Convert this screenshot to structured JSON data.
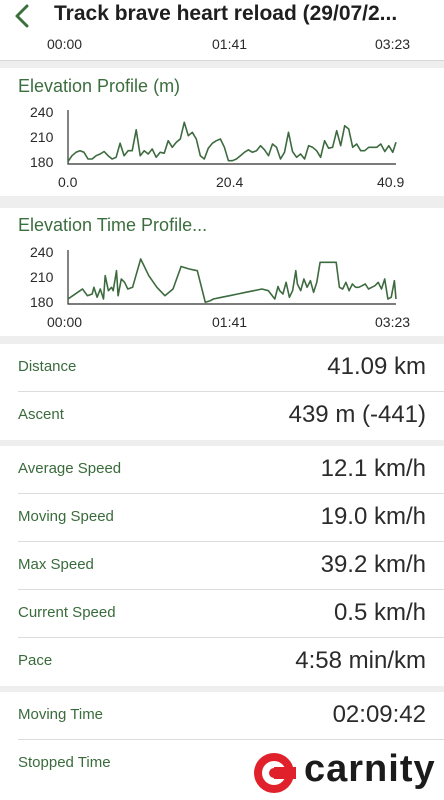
{
  "header": {
    "title": "Track brave heart reload  (29/07/2..."
  },
  "top_axis": {
    "ticks": [
      "00:00",
      "01:41",
      "03:23"
    ]
  },
  "elevation_profile": {
    "title": "Elevation Profile (m)"
  },
  "elevation_time_profile": {
    "title": "Elevation Time Profile..."
  },
  "chart_data": [
    {
      "type": "line",
      "title": "Elevation Profile (m)",
      "xlabel": "",
      "ylabel": "",
      "xlim": [
        0,
        40.9
      ],
      "ylim": [
        180,
        240
      ],
      "y_ticks": [
        "240",
        "210",
        "180"
      ],
      "x_ticks": [
        "0.0",
        "20.4",
        "40.9"
      ],
      "grid": false,
      "color": "#3d6b3f",
      "x": [
        0,
        0.5,
        1,
        1.5,
        2,
        2.5,
        3,
        3.5,
        4,
        4.5,
        5,
        5.5,
        6,
        6.5,
        7,
        7.5,
        8,
        8.5,
        9,
        9.5,
        10,
        10.5,
        11,
        11.5,
        12,
        12.5,
        13,
        13.5,
        14,
        14.5,
        15,
        15.5,
        16,
        16.5,
        17,
        17.5,
        18,
        18.5,
        19,
        19.5,
        20,
        20.5,
        21,
        21.5,
        22,
        22.5,
        23,
        23.5,
        24,
        24.5,
        25,
        25.5,
        26,
        26.5,
        27,
        27.5,
        28,
        28.5,
        29,
        29.5,
        30,
        30.5,
        31,
        31.5,
        32,
        32.5,
        33,
        33.5,
        34,
        34.5,
        35,
        35.5,
        36,
        36.5,
        37,
        37.5,
        38,
        38.5,
        39,
        39.5,
        40,
        40.5,
        40.9
      ],
      "y": [
        183,
        190,
        194,
        196,
        194,
        186,
        186,
        190,
        192,
        195,
        190,
        186,
        188,
        205,
        190,
        196,
        196,
        221,
        190,
        196,
        192,
        198,
        188,
        194,
        193,
        208,
        200,
        206,
        210,
        230,
        214,
        218,
        210,
        190,
        186,
        199,
        205,
        208,
        210,
        200,
        184,
        184,
        186,
        190,
        194,
        197,
        194,
        196,
        202,
        197,
        190,
        204,
        200,
        186,
        194,
        218,
        195,
        188,
        192,
        186,
        202,
        200,
        196,
        188,
        208,
        199,
        200,
        220,
        202,
        226,
        222,
        200,
        204,
        196,
        196,
        200,
        200,
        200,
        204,
        195,
        202,
        194,
        206,
        200,
        202,
        208,
        204,
        206,
        200,
        204,
        198,
        196,
        206,
        186,
        184,
        216,
        184,
        186
      ]
    },
    {
      "type": "line",
      "title": "Elevation Time Profile...",
      "xlabel": "",
      "ylabel": "",
      "xlim": [
        "00:00",
        "03:23"
      ],
      "ylim": [
        180,
        240
      ],
      "y_ticks": [
        "240",
        "210",
        "180"
      ],
      "x_ticks": [
        "00:00",
        "01:41",
        "03:23"
      ],
      "grid": false,
      "color": "#3d6b3f",
      "x": [
        0,
        3,
        6,
        9,
        12,
        15,
        16,
        18,
        20,
        22,
        23,
        25,
        27,
        28,
        30,
        31,
        33,
        35,
        37,
        40,
        42,
        45,
        50,
        55,
        60,
        65,
        70,
        75,
        80,
        85,
        88,
        90,
        95,
        100,
        105,
        110,
        115,
        120,
        124,
        128,
        130,
        131,
        133,
        135,
        137,
        139,
        141,
        142,
        144,
        146,
        148,
        150,
        152,
        154,
        156,
        158,
        160,
        162,
        164,
        166,
        168,
        170,
        172,
        174,
        176,
        178,
        180,
        182,
        184,
        186,
        188,
        190,
        192,
        194,
        196,
        198,
        200,
        202,
        203
      ],
      "y": [
        186,
        190,
        194,
        198,
        190,
        192,
        200,
        188,
        198,
        186,
        214,
        196,
        200,
        196,
        220,
        190,
        210,
        206,
        198,
        200,
        214,
        234,
        214,
        200,
        190,
        198,
        225,
        222,
        220,
        182,
        184,
        186,
        188,
        190,
        192,
        194,
        196,
        198,
        196,
        186,
        201,
        196,
        192,
        206,
        188,
        196,
        220,
        204,
        196,
        210,
        200,
        208,
        194,
        206,
        230,
        230,
        230,
        230,
        230,
        230,
        200,
        198,
        206,
        196,
        204,
        200,
        200,
        202,
        204,
        198,
        200,
        202,
        206,
        198,
        210,
        186,
        188,
        208,
        186
      ]
    },
    {
      "type": "table",
      "title": "",
      "rows": [
        {
          "label": "Distance",
          "value": "41.09 km"
        },
        {
          "label": "Ascent",
          "value": "439 m (-441)"
        },
        {
          "label": "Average Speed",
          "value": "12.1 km/h"
        },
        {
          "label": "Moving Speed",
          "value": "19.0 km/h"
        },
        {
          "label": "Max Speed",
          "value": "39.2 km/h"
        },
        {
          "label": "Current Speed",
          "value": "0.5 km/h"
        },
        {
          "label": "Pace",
          "value": "4:58 min/km"
        },
        {
          "label": "Moving Time",
          "value": "02:09:42"
        },
        {
          "label": "Stopped Time",
          "value": ""
        }
      ]
    }
  ],
  "stats": {
    "distance": {
      "label": "Distance",
      "value": "41.09 km"
    },
    "ascent": {
      "label": "Ascent",
      "value": "439 m (-441)"
    },
    "average_speed": {
      "label": "Average Speed",
      "value": "12.1 km/h"
    },
    "moving_speed": {
      "label": "Moving Speed",
      "value": "19.0 km/h"
    },
    "max_speed": {
      "label": "Max Speed",
      "value": "39.2 km/h"
    },
    "current_speed": {
      "label": "Current Speed",
      "value": "0.5 km/h"
    },
    "pace": {
      "label": "Pace",
      "value": "4:58 min/km"
    },
    "moving_time": {
      "label": "Moving Time",
      "value": "02:09:42"
    },
    "stopped_time": {
      "label": "Stopped Time"
    }
  },
  "watermark": {
    "brand": "carnity",
    "accent_color": "#e0212b"
  }
}
